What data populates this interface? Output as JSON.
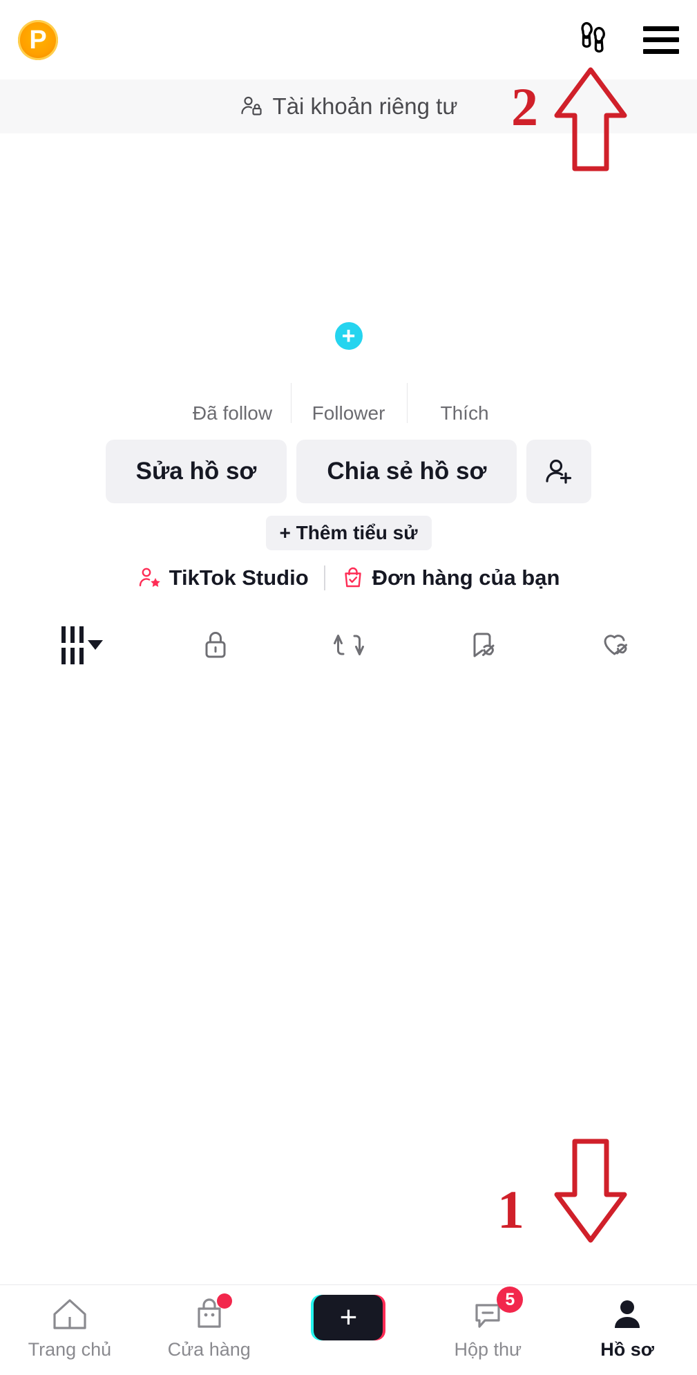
{
  "app": {
    "name": "TikTok",
    "accent_pink": "#fe2c55",
    "accent_cyan": "#25f4ee",
    "annotation_red": "#d0202a"
  },
  "topbar": {
    "coin_letter": "P",
    "coin_icon": "coin-p-icon",
    "footprints_icon": "footprints-icon",
    "menu_icon": "hamburger-menu-icon"
  },
  "private_banner": {
    "icon": "person-lock-icon",
    "label": "Tài khoản riêng tư"
  },
  "profile": {
    "avatar_icon": "avatar-placeholder",
    "add_avatar_label": "+",
    "handle": "",
    "stats": [
      {
        "value": "",
        "label": "Đã follow"
      },
      {
        "value": "",
        "label": "Follower"
      },
      {
        "value": "",
        "label": "Thích"
      }
    ],
    "edit_profile_label": "Sửa hồ sơ",
    "share_profile_label": "Chia sẻ hồ sơ",
    "add_friend_icon": "add-person-icon",
    "add_bio_label": "+ Thêm tiểu sử",
    "links": [
      {
        "label": "TikTok Studio",
        "icon": "person-star-icon"
      },
      {
        "label": "Đơn hàng của bạn",
        "icon": "shopping-bag-check-icon"
      }
    ]
  },
  "content_tabs": [
    {
      "name": "posts-grid-tab",
      "icon": "grid-bars-icon",
      "has_caret": true
    },
    {
      "name": "private-tab",
      "icon": "lock-icon",
      "has_caret": false
    },
    {
      "name": "reposts-tab",
      "icon": "repost-icon",
      "has_caret": false
    },
    {
      "name": "favorites-tab",
      "icon": "bookmark-hidden-icon",
      "has_caret": false
    },
    {
      "name": "liked-tab",
      "icon": "heart-hidden-icon",
      "has_caret": false
    }
  ],
  "bottom_nav": [
    {
      "label": "Trang chủ",
      "icon": "home-icon",
      "active": false,
      "badge": ""
    },
    {
      "label": "Cửa hàng",
      "icon": "shop-bag-icon",
      "active": false,
      "badge": "dot"
    },
    {
      "label": "",
      "icon": "create-plus-icon",
      "active": false,
      "badge": "",
      "plus": "+"
    },
    {
      "label": "Hộp thư",
      "icon": "inbox-message-icon",
      "active": false,
      "badge": "5"
    },
    {
      "label": "Hồ sơ",
      "icon": "profile-person-icon",
      "active": true,
      "badge": ""
    }
  ],
  "annotations": [
    {
      "number": "1",
      "direction": "down",
      "points_at": "profile-tab"
    },
    {
      "number": "2",
      "direction": "up",
      "points_at": "hamburger-menu"
    }
  ]
}
